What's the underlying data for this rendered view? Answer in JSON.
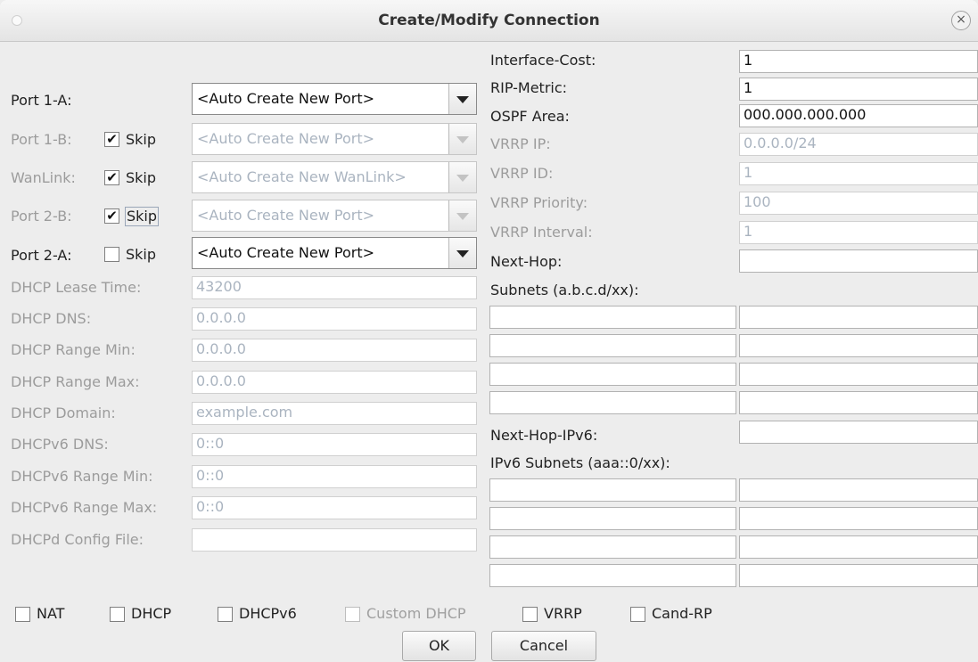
{
  "window": {
    "title": "Create/Modify Connection",
    "close_glyph": "×"
  },
  "left": {
    "port1a": {
      "label": "Port 1-A:",
      "value": "<Auto Create New Port>"
    },
    "port1b": {
      "label": "Port 1-B:",
      "skip_label": "Skip",
      "skip_checked": true,
      "value": "<Auto Create New Port>"
    },
    "wanlink": {
      "label": "WanLink:",
      "skip_label": "Skip",
      "skip_checked": true,
      "value": "<Auto Create New WanLink>"
    },
    "port2b": {
      "label": "Port 2-B:",
      "skip_label": "Skip",
      "skip_checked": true,
      "value": "<Auto Create New Port>"
    },
    "port2a": {
      "label": "Port 2-A:",
      "skip_label": "Skip",
      "skip_checked": false,
      "value": "<Auto Create New Port>"
    },
    "dhcp_fields": [
      {
        "label": "DHCP Lease Time:",
        "value": "43200"
      },
      {
        "label": "DHCP DNS:",
        "value": "0.0.0.0"
      },
      {
        "label": "DHCP Range Min:",
        "value": "0.0.0.0"
      },
      {
        "label": "DHCP Range Max:",
        "value": "0.0.0.0"
      },
      {
        "label": "DHCP Domain:",
        "value": "example.com"
      },
      {
        "label": "DHCPv6 DNS:",
        "value": "0::0"
      },
      {
        "label": "DHCPv6 Range Min:",
        "value": "0::0"
      },
      {
        "label": "DHCPv6 Range Max:",
        "value": "0::0"
      },
      {
        "label": "DHCPd Config File:",
        "value": ""
      }
    ]
  },
  "right": {
    "fields": [
      {
        "label": "Interface-Cost:",
        "value": "1",
        "enabled": true
      },
      {
        "label": "RIP-Metric:",
        "value": "1",
        "enabled": true
      },
      {
        "label": "OSPF Area:",
        "value": "000.000.000.000",
        "enabled": true
      },
      {
        "label": "VRRP IP:",
        "value": "0.0.0.0/24",
        "enabled": false
      },
      {
        "label": "VRRP ID:",
        "value": "1",
        "enabled": false
      },
      {
        "label": "VRRP Priority:",
        "value": "100",
        "enabled": false
      },
      {
        "label": "VRRP Interval:",
        "value": "1",
        "enabled": false
      },
      {
        "label": "Next-Hop:",
        "value": "",
        "enabled": true
      }
    ],
    "subnets_label": "Subnets (a.b.c.d/xx):",
    "next_hop_ipv6_label": "Next-Hop-IPv6:",
    "ipv6_subnets_label": "IPv6 Subnets (aaa::0/xx):"
  },
  "options": [
    {
      "label": "NAT",
      "checked": false,
      "enabled": true
    },
    {
      "label": "DHCP",
      "checked": false,
      "enabled": true
    },
    {
      "label": "DHCPv6",
      "checked": false,
      "enabled": true
    },
    {
      "label": "Custom DHCP",
      "checked": false,
      "enabled": false
    },
    {
      "label": "VRRP",
      "checked": false,
      "enabled": true
    },
    {
      "label": "Cand-RP",
      "checked": false,
      "enabled": true
    }
  ],
  "buttons": {
    "ok": "OK",
    "cancel": "Cancel"
  }
}
